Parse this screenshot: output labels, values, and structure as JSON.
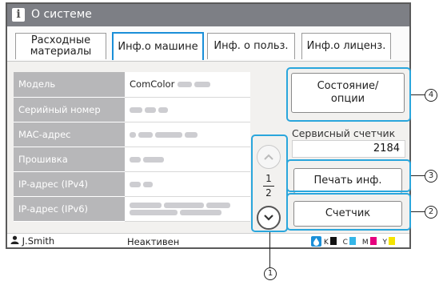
{
  "window": {
    "title": "О системе",
    "icon": "info-icon"
  },
  "tabs": [
    {
      "label_1": "Расходные",
      "label_2": "материалы",
      "active": false
    },
    {
      "label": "Инф.о машине",
      "active": true
    },
    {
      "label": "Инф. о польз.",
      "active": false
    },
    {
      "label": "Инф.о лиценз.",
      "active": false
    }
  ],
  "machine_info": [
    {
      "label": "Модель",
      "value": "ComColor"
    },
    {
      "label": "Серийный номер",
      "value": ""
    },
    {
      "label": "MAC-адрес",
      "value": ""
    },
    {
      "label": "Прошивка",
      "value": ""
    },
    {
      "label": "IP-адрес (IPv4)",
      "value": ""
    },
    {
      "label": "IP-адрес (IPv6)",
      "value": ""
    }
  ],
  "pager": {
    "current": "1",
    "total": "2"
  },
  "buttons": {
    "status_options_1": "Состояние/",
    "status_options_2": "опции",
    "print_info": "Печать инф.",
    "counter": "Счетчик"
  },
  "service_counter": {
    "label": "Сервисный счетчик",
    "value": "2184"
  },
  "status_bar": {
    "user": "J.Smith",
    "state": "Неактивен",
    "inks": [
      {
        "label": "K",
        "color": "#111111"
      },
      {
        "label": "C",
        "color": "#34b6e8"
      },
      {
        "label": "M",
        "color": "#e6007e"
      },
      {
        "label": "Y",
        "color": "#f5e400"
      }
    ]
  },
  "callouts": [
    "1",
    "2",
    "3",
    "4"
  ],
  "colors": {
    "accent": "#1a8fd8",
    "highlight": "#2aa6dc",
    "titlebar": "#7d7f85"
  }
}
